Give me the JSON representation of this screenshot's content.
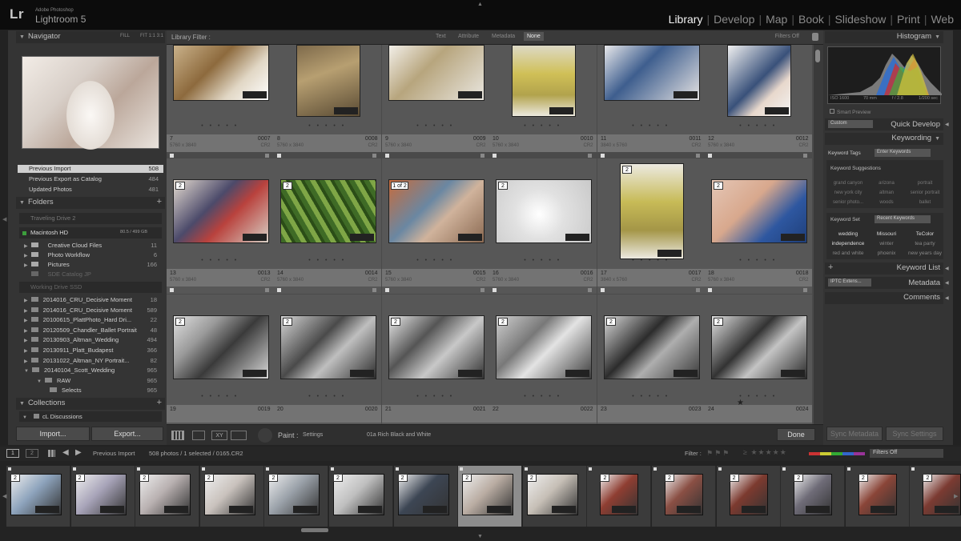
{
  "app": {
    "logo": "Lr",
    "adobe_label": "Adobe Photoshop",
    "name": "Lightroom 5"
  },
  "modules": [
    "Library",
    "Develop",
    "Map",
    "Book",
    "Slideshow",
    "Print",
    "Web"
  ],
  "active_module": "Library",
  "navigator": {
    "title": "Navigator",
    "zoom_options": [
      "FIT",
      "FILL",
      "1:1",
      "3:1"
    ]
  },
  "catalog": {
    "items": [
      {
        "label": "Previous Import",
        "count": "508"
      },
      {
        "label": "Previous Export as Catalog",
        "count": "484"
      },
      {
        "label": "Updated Photos",
        "count": "481"
      }
    ]
  },
  "folders": {
    "title": "Folders",
    "drives": [
      {
        "label": "Traveling Drive 2",
        "info": ""
      },
      {
        "label": "Macintosh HD",
        "info": "80.5 / 499 GB"
      }
    ],
    "mac_items": [
      {
        "label": "Creative Cloud Files",
        "count": "11"
      },
      {
        "label": "Photo Workflow",
        "count": "6"
      },
      {
        "label": "Pictures",
        "count": "166"
      },
      {
        "label": "SDE Catalog JP",
        "count": ""
      }
    ],
    "ssd": {
      "label": "Working Drive SSD"
    },
    "ssd_items": [
      {
        "label": "2014016_CRU_Decisive Moment",
        "count": "18"
      },
      {
        "label": "2014016_CRU_Decisive Moment",
        "count": "589"
      },
      {
        "label": "20100615_PlattPhoto_Hard Dri...",
        "count": "22"
      },
      {
        "label": "20120509_Chandler_Ballet Portrait",
        "count": "48"
      },
      {
        "label": "20130903_Altman_Wedding",
        "count": "494"
      },
      {
        "label": "20130911_Platt_Budapest",
        "count": "366"
      },
      {
        "label": "20131022_Altman_NY Portrait...",
        "count": "82"
      },
      {
        "label": "20140104_Scott_Wedding",
        "count": "965"
      },
      {
        "label": "RAW",
        "count": "965"
      },
      {
        "label": "Selects",
        "count": "965"
      }
    ]
  },
  "collections": {
    "title": "Collections",
    "items": [
      {
        "label": "cL Discussions"
      }
    ]
  },
  "left_buttons": {
    "import": "Import...",
    "export": "Export..."
  },
  "filter_bar": {
    "label": "Library Filter :",
    "options": [
      "Text",
      "Attribute",
      "Metadata",
      "None"
    ],
    "active": "None",
    "filters_state": "Filters Off"
  },
  "grid": {
    "rows": [
      {
        "cells": [
          {
            "num": "7",
            "file": "0007",
            "dims": "5760 x 3840",
            "ext": "CR2"
          },
          {
            "num": "8",
            "file": "0008",
            "dims": "5760 x 3840",
            "ext": "CR2"
          },
          {
            "num": "9",
            "file": "0009",
            "dims": "5760 x 3840",
            "ext": "CR2"
          },
          {
            "num": "10",
            "file": "0010",
            "dims": "5760 x 3840",
            "ext": "CR2"
          },
          {
            "num": "11",
            "file": "0011",
            "dims": "3840 x 5760",
            "ext": "CR2"
          },
          {
            "num": "12",
            "file": "0012",
            "dims": "5760 x 3840",
            "ext": "CR2"
          }
        ]
      },
      {
        "cells": [
          {
            "num": "13",
            "file": "0013",
            "dims": "5760 x 3840",
            "ext": "CR2"
          },
          {
            "num": "14",
            "file": "0014",
            "dims": "5760 x 3840",
            "ext": "CR2"
          },
          {
            "num": "15",
            "file": "0015",
            "dims": "5760 x 3840",
            "ext": "CR2"
          },
          {
            "num": "16",
            "file": "0016",
            "dims": "5760 x 3840",
            "ext": "CR2"
          },
          {
            "num": "17",
            "file": "0017",
            "dims": "3840 x 5760",
            "ext": "CR2"
          },
          {
            "num": "18",
            "file": "0018",
            "dims": "5760 x 3840",
            "ext": "CR2"
          }
        ]
      },
      {
        "cells": [
          {
            "num": "19",
            "file": "0019"
          },
          {
            "num": "20",
            "file": "0020"
          },
          {
            "num": "21",
            "file": "0021"
          },
          {
            "num": "22",
            "file": "0022"
          },
          {
            "num": "23",
            "file": "0023"
          },
          {
            "num": "24",
            "file": "0024"
          }
        ]
      }
    ],
    "stack_badges": [
      "2",
      "2",
      "1 of 2",
      "2",
      "2",
      "2"
    ],
    "row3_badges": [
      "2",
      "2",
      "2",
      "2",
      "2",
      "2"
    ]
  },
  "toolbar": {
    "paint_label": "Paint :",
    "settings_label": "Settings",
    "preset": "01a Rich Black and White",
    "done": "Done"
  },
  "right_panel": {
    "histogram": {
      "title": "Histogram",
      "iso": "ISO 1600",
      "focal": "70 mm",
      "aperture": "f / 2.8",
      "shutter": "1/200 sec",
      "smart_preview": "Smart Preview"
    },
    "quick_develop": {
      "title": "Quick Develop",
      "preset": "Custom"
    },
    "keywording": {
      "title": "Keywording",
      "tags_label": "Keyword Tags",
      "tags_value": "Enter Keywords",
      "suggestions_label": "Keyword Suggestions",
      "suggestions": [
        "grand canyon",
        "arizona",
        "portrait",
        "new york city",
        "altman",
        "senior portrait",
        "senior photo...",
        "woods",
        "ballet"
      ],
      "set_label": "Keyword Set",
      "set_value": "Recent Keywords",
      "set_items": [
        "wedding",
        "Missouri",
        "TeColor",
        "independence",
        "winter",
        "tea party",
        "red and white",
        "phoenix",
        "new years day"
      ]
    },
    "keyword_list": {
      "title": "Keyword List"
    },
    "metadata": {
      "title": "Metadata",
      "preset": "IPTC Extens..."
    },
    "comments": {
      "title": "Comments"
    },
    "sync_metadata": "Sync Metadata",
    "sync_settings": "Sync Settings"
  },
  "filmstrip_bar": {
    "screens": [
      "1",
      "2"
    ],
    "source": "Previous Import",
    "info": "508 photos / 1 selected / 0165.CR2",
    "filter_label": "Filter :",
    "filter_state": "Filters Off"
  },
  "filmstrip": {
    "badges": [
      "2",
      "2",
      "2",
      "2",
      "2",
      "2",
      "2",
      "2",
      "2",
      "2",
      "2",
      "2",
      "2",
      "2",
      "2"
    ]
  }
}
